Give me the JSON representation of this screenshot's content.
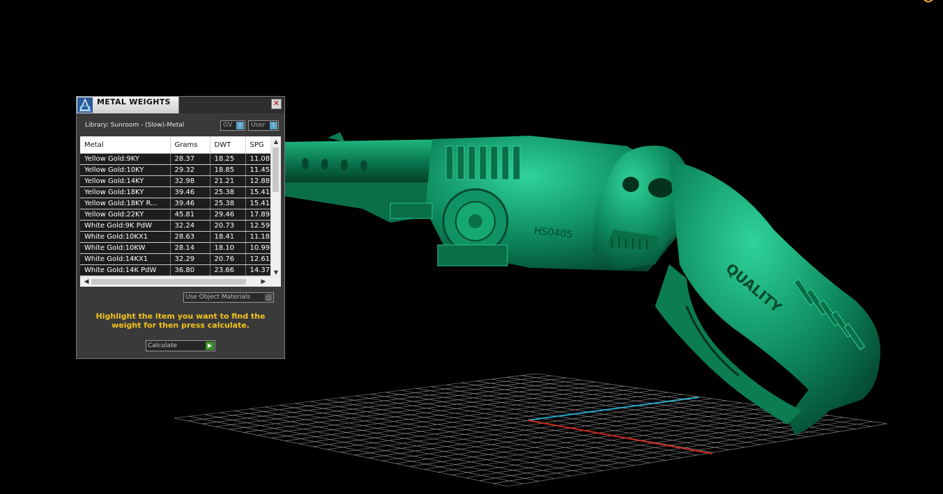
{
  "panel": {
    "title": "METAL WEIGHTS",
    "close_glyph": "✕",
    "library": "Library: Sunroom - (Slow)-Metal",
    "unit_gv": "GV",
    "unit_user": "User",
    "toggle_glyph": "!",
    "use_object_materials": "Use Object Materials",
    "instruction": "Highlight the item you want to find the weight for then press calculate.",
    "calculate": "Calculate",
    "calc_glyph": "▶"
  },
  "table": {
    "columns": [
      "Metal",
      "Grams",
      "DWT",
      "SPG"
    ],
    "rows": [
      [
        "Yellow Gold:9KY",
        "28.37",
        "18.25",
        "11.08"
      ],
      [
        "Yellow Gold:10KY",
        "29.32",
        "18.85",
        "11.45"
      ],
      [
        "Yellow Gold:14KY",
        "32.98",
        "21.21",
        "12.88"
      ],
      [
        "Yellow Gold:18KY",
        "39.46",
        "25.38",
        "15.41"
      ],
      [
        "Yellow Gold:18KY R...",
        "39.46",
        "25.38",
        "15.41"
      ],
      [
        "Yellow Gold:22KY",
        "45.81",
        "29.46",
        "17.89"
      ],
      [
        "White Gold:9K PdW",
        "32.24",
        "20.73",
        "12.59"
      ],
      [
        "White Gold:10KX1",
        "28.63",
        "18.41",
        "11.18"
      ],
      [
        "White Gold:10KW",
        "28.14",
        "18.10",
        "10.99"
      ],
      [
        "White Gold:14KX1",
        "32.29",
        "20.76",
        "12.61"
      ],
      [
        "White Gold:14K PdW",
        "36.80",
        "23.66",
        "14.37"
      ]
    ]
  },
  "scroll_glyphs": {
    "up": "▲",
    "down": "▼",
    "left": "◀",
    "right": "▶"
  },
  "viewport": {
    "model_color": "#0e8a5e",
    "axis_x_color": "#cc2a1a",
    "axis_y_color": "#2aa9c9",
    "model_engravings": [
      "HS0405",
      "QUALITY"
    ]
  },
  "icons": {
    "app_logo": "app-logo-icon",
    "close": "close-icon",
    "corner": "corner-mark-icon"
  }
}
